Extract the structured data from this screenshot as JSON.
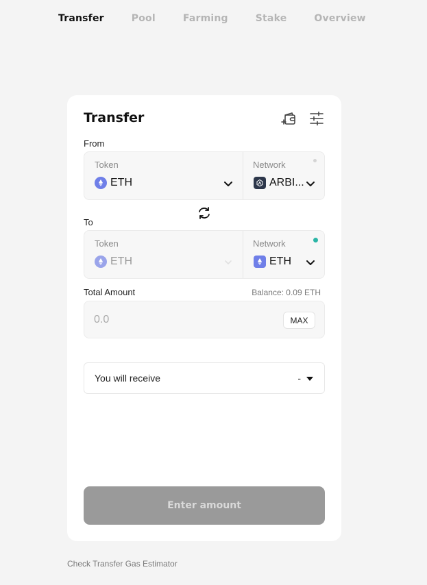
{
  "nav": {
    "tabs": [
      {
        "label": "Transfer",
        "active": true
      },
      {
        "label": "Pool",
        "active": false
      },
      {
        "label": "Farming",
        "active": false
      },
      {
        "label": "Stake",
        "active": false
      },
      {
        "label": "Overview",
        "active": false
      }
    ]
  },
  "card": {
    "title": "Transfer",
    "icons": {
      "wallet": "wallet-add-icon",
      "settings": "sliders-icon"
    }
  },
  "from": {
    "label": "From",
    "token_label": "Token",
    "token_value": "ETH",
    "token_icon": "eth-icon",
    "network_label": "Network",
    "network_value": "ARBI...",
    "network_icon": "arbitrum-icon",
    "status_color": "#d4d4d4"
  },
  "swap": {
    "icon": "swap-icon"
  },
  "to": {
    "label": "To",
    "token_label": "Token",
    "token_value": "ETH",
    "token_icon": "eth-icon",
    "network_label": "Network",
    "network_value": "ETH",
    "network_icon": "eth-icon",
    "status_color": "#2bb5a6"
  },
  "amount": {
    "label": "Total Amount",
    "balance": "Balance: 0.09 ETH",
    "placeholder": "0.0",
    "value": "",
    "max_label": "MAX"
  },
  "receive": {
    "label": "You will receive",
    "value": "-"
  },
  "submit": {
    "label": "Enter amount"
  },
  "footer": {
    "link": "Check Transfer Gas Estimator"
  },
  "colors": {
    "accent_eth": "#6f7fe8",
    "button_disabled": "#9a9a9a",
    "background": "#f4f4f4"
  }
}
